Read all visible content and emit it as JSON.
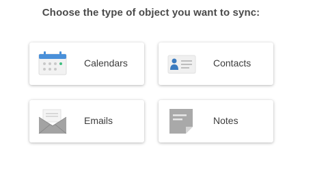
{
  "prompt": "Choose the type of object you want to sync:",
  "options": [
    {
      "label": "Calendars",
      "icon": "calendar-icon"
    },
    {
      "label": "Contacts",
      "icon": "contact-card-icon"
    },
    {
      "label": "Emails",
      "icon": "envelope-icon"
    },
    {
      "label": "Notes",
      "icon": "note-icon"
    }
  ],
  "colors": {
    "heading": "#4a4a4a",
    "label": "#3c3c3c",
    "calendar_header": "#4a90d9",
    "calendar_dot_green": "#3fbf7f",
    "contact_person": "#3b7bbf",
    "icon_gray": "#9c9c9c"
  }
}
